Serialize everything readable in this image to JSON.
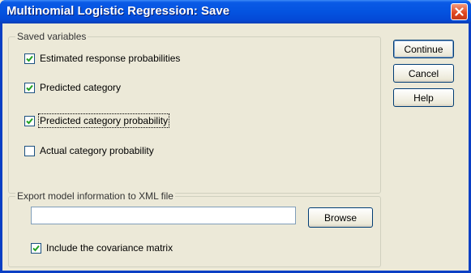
{
  "window": {
    "title": "Multinomial Logistic Regression: Save"
  },
  "saved_variables": {
    "legend": "Saved variables",
    "items": [
      {
        "label": "Estimated response probabilities",
        "checked": true
      },
      {
        "label": "Predicted category",
        "checked": true
      },
      {
        "label": "Predicted category probability",
        "checked": true
      },
      {
        "label": "Actual category probability",
        "checked": false
      }
    ]
  },
  "export": {
    "legend": "Export model information to XML file",
    "file_value": "",
    "browse_label": "Browse",
    "include_covariance_label": "Include the covariance matrix",
    "include_covariance_checked": true
  },
  "buttons": {
    "continue_label": "Continue",
    "cancel_label": "Cancel",
    "help_label": "Help"
  },
  "icons": {
    "close": "close-icon",
    "check": "check-icon"
  }
}
